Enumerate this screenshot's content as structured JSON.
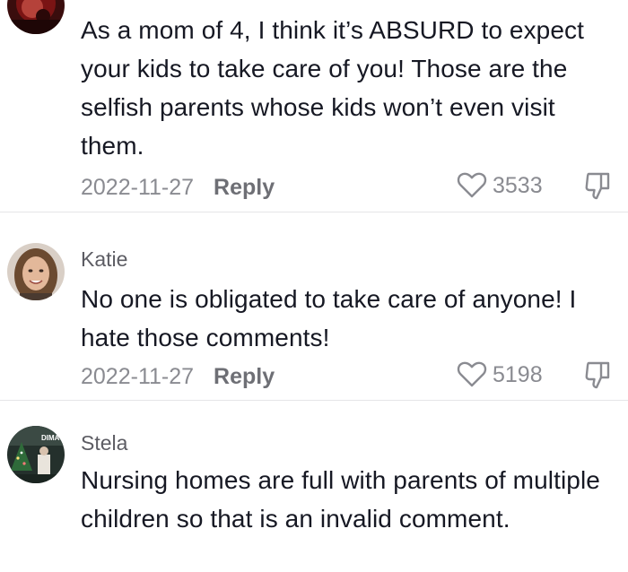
{
  "comments": [
    {
      "username": "",
      "text": "As a mom of 4, I think it’s ABSURD to expect your kids to take care of you! Those are the selfish parents whose kids won’t even visit them.",
      "date": "2022-11-27",
      "reply_label": "Reply",
      "likes": "3533",
      "avatar_icon": "profile-photo-dark-red"
    },
    {
      "username": "Katie",
      "text": "No one is obligated to take care of anyone! I hate those comments!",
      "date": "2022-11-27",
      "reply_label": "Reply",
      "likes": "5198",
      "avatar_icon": "profile-photo-woman-smiling"
    },
    {
      "username": "Stela",
      "text": "Nursing homes are full with parents of multiple children so that is an invalid comment.",
      "date": "",
      "reply_label": "",
      "likes": "",
      "avatar_icon": "profile-photo-christmas-tree",
      "avatar_text": "DIMACH"
    }
  ],
  "icons": {
    "like": "heart-outline-icon",
    "dislike": "thumbs-down-outline-icon"
  },
  "colors": {
    "text": "#161823",
    "muted": "#8a8b91",
    "divider": "#e6e6e8"
  }
}
